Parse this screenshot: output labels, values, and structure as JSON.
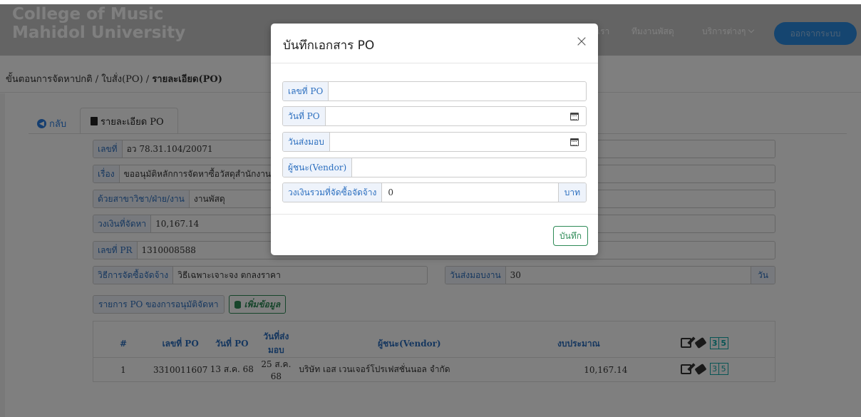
{
  "header": {
    "brand_line1": "College of Music",
    "brand_line2": "Mahidol University",
    "nav_about": "เรา",
    "nav_team": "ทีมงานพัสดุ",
    "nav_services": "บริการต่างๆ",
    "logout": "ออกจากระบบ"
  },
  "breadcrumb": {
    "step1": "ขั้นตอนการจัดหาปกติ",
    "sep": " / ",
    "step2": "ใบสั่ง(PO)",
    "step3": "รายละเอียด(PO)"
  },
  "tabs": {
    "back": "กลับ",
    "detail": "รายละเอียด PO"
  },
  "info": {
    "doc_no_label": "เลขที่",
    "doc_no_value": "อว 78.31.104/20071",
    "subject_label": "เรื่อง",
    "subject_value": "ขออนุมัติหลักการจัดหาซื้อวัสดุสำนักงาน",
    "dept_label": "ด้วยสาขาวิชา/ฝ่าย/งาน",
    "dept_value": "งานพัสดุ",
    "budget_label": "วงเงินที่จัดหา",
    "budget_value": "10,167.14",
    "pr_label": "เลขที่ PR",
    "pr_value": "1310008588",
    "method_label": "วิธีการจัดซื้อจัดจ้าง",
    "method_value": "วิธีเฉพาะเจาะจง ตกลงราคา",
    "delivery_label": "วันส่งมอบงาน",
    "delivery_value": "30",
    "delivery_unit": "วัน"
  },
  "po_section": {
    "label": "รายการ PO ของการอนุมัติจัดหา",
    "add_button": "เพิ่มข้อมูล"
  },
  "table": {
    "headers": [
      "#",
      "เลขที่ PO",
      "วันที่ PO",
      "วันที่ส่งมอบ",
      "ผู้ชนะ(Vendor)",
      "งบประมาณ"
    ],
    "header_digits": [
      "3",
      "5"
    ],
    "rows": [
      {
        "no": "1",
        "po_no": "3310011607",
        "po_date": "13 ส.ค. 68",
        "delivery_date": "25 ส.ค. 68",
        "vendor": "บริษัท เอส เวนเจอร์โปรเฟสชั่นนอล จำกัด",
        "amount": "10,167.14",
        "digits": [
          "3",
          "5"
        ]
      }
    ]
  },
  "modal": {
    "title": "บันทึกเอกสาร PO",
    "close": "×",
    "fields": {
      "po_no_label": "เลขที่ PO",
      "po_no_value": "",
      "po_date_label": "วันที่ PO",
      "po_date_value": "",
      "delivery_label": "วันส่งมอบ",
      "delivery_value": "",
      "vendor_label": "ผู้ชนะ(Vendor)",
      "vendor_value": "",
      "amount_label": "วงเงินรวมที่จัดซื้อจัดจ้าง",
      "amount_value": "0",
      "amount_unit": "บาท"
    },
    "save": "บันทึก"
  },
  "colors": {
    "overlay": "rgba(0,0,0,0.5)",
    "label_text": "#2c6fbf",
    "label_bg": "#eef3fb",
    "save_green": "#2e8b57",
    "logout_blue": "#2a8be0"
  },
  "icons": [
    "chevron-down-icon",
    "arrow-left-circle-icon",
    "document-icon",
    "database-icon",
    "edit-icon",
    "eraser-icon",
    "calendar-icon",
    "close-icon"
  ]
}
